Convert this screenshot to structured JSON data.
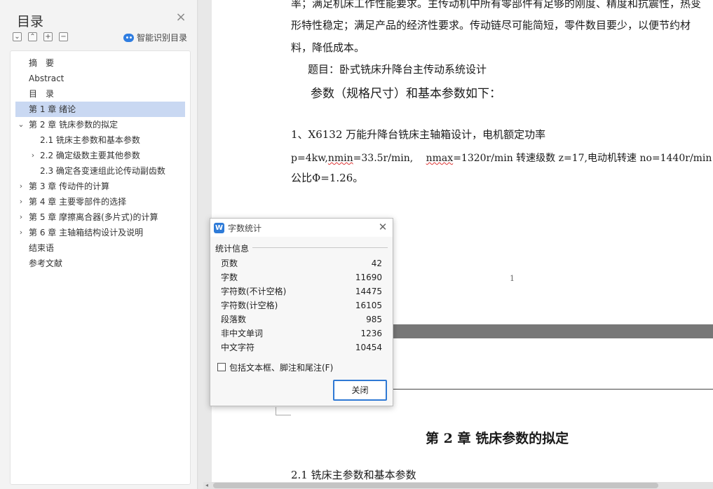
{
  "sidebar": {
    "title": "目录",
    "smart_toc_label": "智能识别目录",
    "tools": [
      "⌄",
      "⌃",
      "+",
      "−"
    ],
    "items": [
      {
        "label": "摘　要",
        "arrow": ""
      },
      {
        "label": "Abstract",
        "arrow": ""
      },
      {
        "label": "目　录",
        "arrow": ""
      },
      {
        "label": "第 1 章  绪论",
        "arrow": "",
        "active": true
      },
      {
        "label": "第 2 章  铣床参数的拟定",
        "arrow": "⌄"
      },
      {
        "label": "2.1 铣床主参数和基本参数",
        "arrow": ""
      },
      {
        "label": "2.2 确定级数主要其他参数",
        "arrow": "›"
      },
      {
        "label": "2.3  确定各变速组此论传动副齿数",
        "arrow": ""
      },
      {
        "label": "第 3 章  传动件的计算",
        "arrow": "›"
      },
      {
        "label": "第 4 章  主要零部件的选择",
        "arrow": "›"
      },
      {
        "label": "第 5 章    摩擦离合器(多片式)的计算",
        "arrow": "›"
      },
      {
        "label": "第 6 章  主轴箱结构设计及说明",
        "arrow": "›"
      },
      {
        "label": "结束语",
        "arrow": ""
      },
      {
        "label": "参考文献",
        "arrow": ""
      }
    ]
  },
  "document": {
    "line1": "率；满足机床工作性能要求。主传动机中所有零部件有足够的刚度、精度和抗震性，热变",
    "line2": "形特性稳定；满足产品的经济性要求。传动链尽可能简短，零件数目要少，以便节约材",
    "line3": "料，降低成本。",
    "topic": "题目：卧式铣床升降台主传动系统设计",
    "params_heading": "参数（规格尺寸）和基本参数如下：",
    "item1": "1、X6132 万能升降台铣床主轴箱设计，电机额定功率",
    "formula_a": "p=4kw,",
    "formula_b": "nmin",
    "formula_c": "=33.5r/min,　 ",
    "formula_d": "nmax",
    "formula_e": "=1320r/min 转速级数 z=17,电动机转速 no=1440r/min，",
    "ratio": "公比Φ=1.26。",
    "page_number": "1",
    "chapter2_title": "第 2 章  铣床参数的拟定",
    "section21": "2.1 铣床主参数和基本参数"
  },
  "dialog": {
    "title": "字数统计",
    "group_label": "统计信息",
    "stats": [
      {
        "label": "页数",
        "value": "42"
      },
      {
        "label": "字数",
        "value": "11690"
      },
      {
        "label": "字符数(不计空格)",
        "value": "14475"
      },
      {
        "label": "字符数(计空格)",
        "value": "16105"
      },
      {
        "label": "段落数",
        "value": "985"
      },
      {
        "label": "非中文单词",
        "value": "1236"
      },
      {
        "label": "中文字符",
        "value": "10454"
      }
    ],
    "checkbox_label": "包括文本框、脚注和尾注(F)",
    "close_button": "关闭",
    "logo": "W"
  },
  "colors": {
    "accent": "#2f79d4",
    "toc_active": "#c9d8f2",
    "spell_error": "#d33333"
  }
}
